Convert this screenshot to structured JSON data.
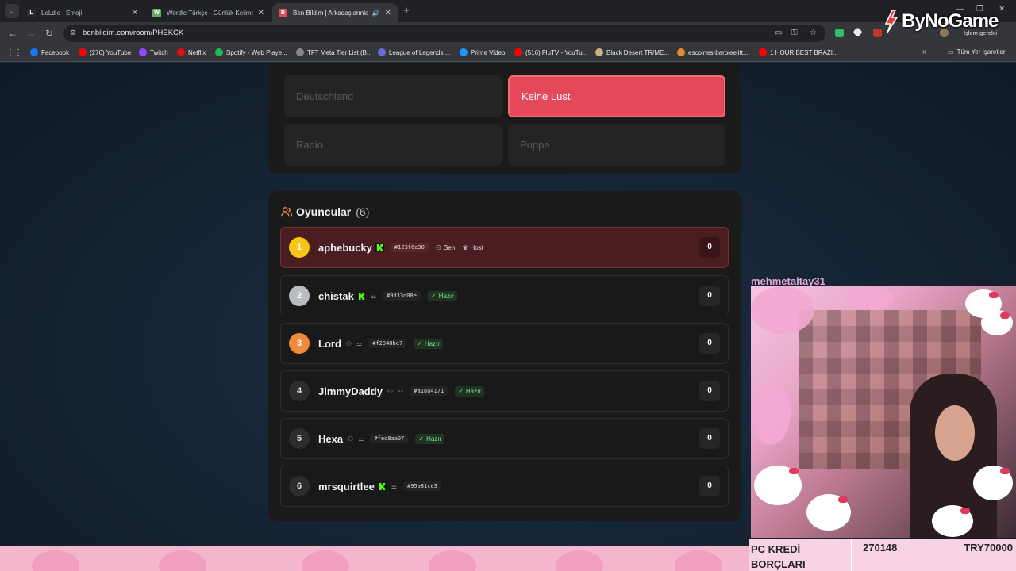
{
  "browser": {
    "tabs": [
      {
        "title": "LoLdle - Emoji",
        "favicon": "L",
        "color": "#2b2b2b",
        "active": false
      },
      {
        "title": "Wordle Türkçe - Günlük Kelime",
        "favicon": "W",
        "color": "#6aaa64",
        "active": false
      },
      {
        "title": "Ben Bildim | Arkadaşlarınla",
        "favicon": "B",
        "color": "#e5485a",
        "active": true
      }
    ],
    "url": "benbildim.com/room/PHEKCK",
    "profile_label": "İşlem gerekli",
    "bookmarks": [
      {
        "label": "Facebook",
        "color": "#1877f2"
      },
      {
        "label": "(276) YouTube",
        "color": "#ff0000"
      },
      {
        "label": "Twitch",
        "color": "#9146ff"
      },
      {
        "label": "Netflix",
        "color": "#e50914"
      },
      {
        "label": "Spotify - Web Playe...",
        "color": "#1db954"
      },
      {
        "label": "TFT Meta Tier List (B...",
        "color": "#888888"
      },
      {
        "label": "League of Legends:...",
        "color": "#6b6bd6"
      },
      {
        "label": "Prime Video",
        "color": "#1a98ff"
      },
      {
        "label": "(516) FluTV - YouTu...",
        "color": "#ff0000"
      },
      {
        "label": "Black Desert TR/ME...",
        "color": "#c9b28a"
      },
      {
        "label": "escoines-barbieelitt...",
        "color": "#e08a2b"
      },
      {
        "label": "1 HOUR BEST BRAZI...",
        "color": "#ff0000"
      }
    ],
    "all_bookmarks_label": "Tüm Yer İşaretleri"
  },
  "answers": [
    {
      "label": "Deutschland",
      "selected": false
    },
    {
      "label": "Keine Lust",
      "selected": true
    },
    {
      "label": "Radio",
      "selected": false
    },
    {
      "label": "Puppe",
      "selected": false
    }
  ],
  "players": {
    "title": "Oyuncular",
    "count": "(6)",
    "list": [
      {
        "rank": "1",
        "name": "aphebucky",
        "kick": true,
        "id": "#123f6e30",
        "sen": "Sen",
        "host": "Host",
        "ready": "",
        "score": "0",
        "me": true,
        "medal": "gold"
      },
      {
        "rank": "2",
        "name": "chistak",
        "kick": true,
        "id": "#9d33d08e",
        "sen": "",
        "host": "",
        "ready": "Hazır",
        "score": "0",
        "me": false,
        "medal": "silver"
      },
      {
        "rank": "3",
        "name": "Lord",
        "kick": false,
        "id": "#f2948be7",
        "sen": "",
        "host": "",
        "ready": "Hazır",
        "score": "0",
        "me": false,
        "medal": "bronze"
      },
      {
        "rank": "4",
        "name": "JimmyDaddy",
        "kick": false,
        "id": "#a18a4171",
        "sen": "",
        "host": "",
        "ready": "Hazır",
        "score": "0",
        "me": false,
        "medal": ""
      },
      {
        "rank": "5",
        "name": "Hexa",
        "kick": false,
        "id": "#fed8aa07",
        "sen": "",
        "host": "",
        "ready": "Hazır",
        "score": "0",
        "me": false,
        "medal": ""
      },
      {
        "rank": "6",
        "name": "mrsquirtlee",
        "kick": true,
        "id": "#95a81ce3",
        "sen": "",
        "host": "",
        "ready": "",
        "score": "0",
        "me": false,
        "medal": ""
      }
    ]
  },
  "overlay": {
    "cam_name": "mehmetaltay31",
    "logo_text": "ByNoGame",
    "kredi_label_1": "PC KREDİ",
    "kredi_label_2": "BORÇLARI",
    "kredi_amount": "270148",
    "kredi_try": "TRY70000"
  },
  "colors": {
    "accent": "#e5485a",
    "ready": "#7ee08e",
    "kick": "#53fc18"
  }
}
